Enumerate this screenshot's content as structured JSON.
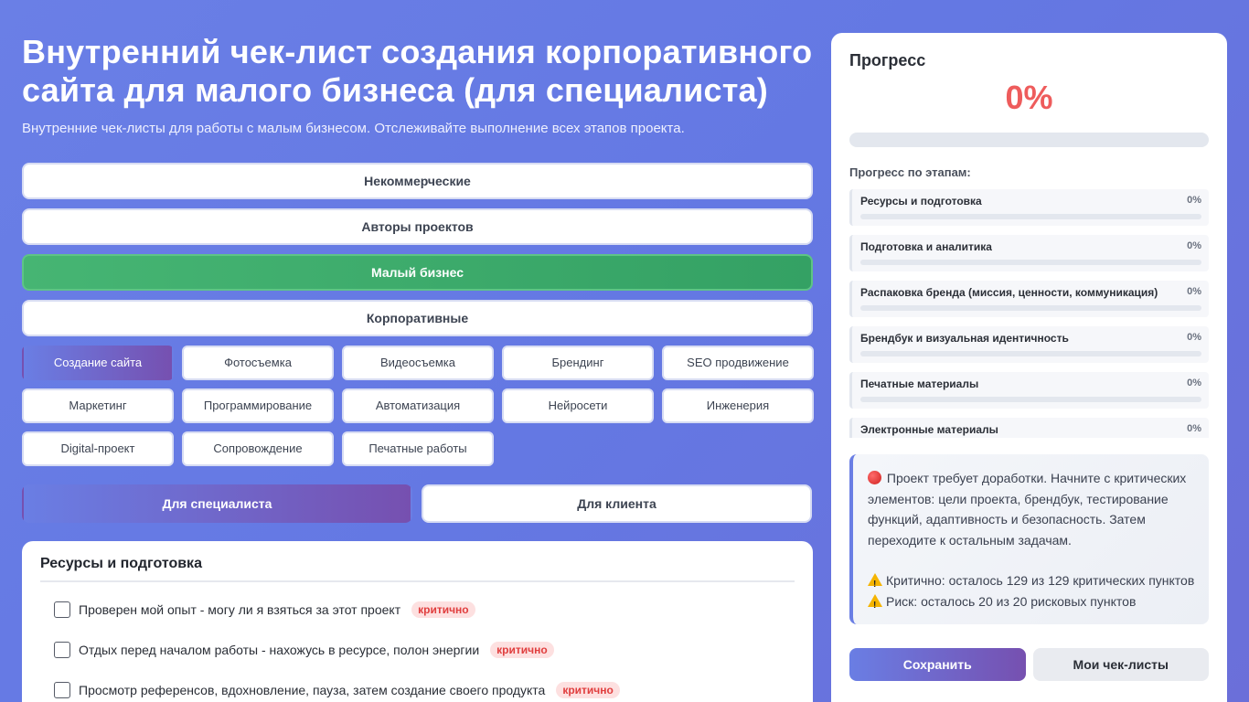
{
  "header": {
    "title": "Внутренний чек-лист создания корпоративного сайта для малого бизнеса (для специалиста)",
    "subtitle": "Внутренние чек-листы для работы с малым бизнесом. Отслеживайте выполнение всех этапов проекта."
  },
  "categories": [
    {
      "label": "Некоммерческие",
      "active": false
    },
    {
      "label": "Авторы проектов",
      "active": false
    },
    {
      "label": "Малый бизнес",
      "active": true
    },
    {
      "label": "Корпоративные",
      "active": false
    }
  ],
  "services": [
    {
      "label": "Создание сайта",
      "active": true
    },
    {
      "label": "Фотосъемка",
      "active": false
    },
    {
      "label": "Видеосъемка",
      "active": false
    },
    {
      "label": "Брендинг",
      "active": false
    },
    {
      "label": "SEO продвижение",
      "active": false
    },
    {
      "label": "Маркетинг",
      "active": false
    },
    {
      "label": "Программирование",
      "active": false
    },
    {
      "label": "Автоматизация",
      "active": false
    },
    {
      "label": "Нейросети",
      "active": false
    },
    {
      "label": "Инженерия",
      "active": false
    },
    {
      "label": "Digital-проект",
      "active": false
    },
    {
      "label": "Сопровождение",
      "active": false
    },
    {
      "label": "Печатные работы",
      "active": false
    }
  ],
  "modes": [
    {
      "label": "Для специалиста",
      "active": true
    },
    {
      "label": "Для клиента",
      "active": false
    }
  ],
  "section": {
    "title": "Ресурсы и подготовка",
    "tasks": [
      {
        "text": "Проверен мой опыт - могу ли я взяться за этот проект",
        "badge": "критично",
        "checked": false
      },
      {
        "text": "Отдых перед началом работы - нахожусь в ресурсе, полон энергии",
        "badge": "критично",
        "checked": false
      },
      {
        "text": "Просмотр референсов, вдохновление, пауза, затем создание своего продукта",
        "badge": "критично",
        "checked": false
      }
    ]
  },
  "progress": {
    "title": "Прогресс",
    "percent_label": "0%",
    "percent_value": 0,
    "stages_title": "Прогресс по этапам:",
    "stages": [
      {
        "name": "Ресурсы и подготовка",
        "pct_label": "0%",
        "value": 0
      },
      {
        "name": "Подготовка и аналитика",
        "pct_label": "0%",
        "value": 0
      },
      {
        "name": "Распаковка бренда (миссия, ценности, коммуникация)",
        "pct_label": "0%",
        "value": 0
      },
      {
        "name": "Брендбук и визуальная идентичность",
        "pct_label": "0%",
        "value": 0
      },
      {
        "name": "Печатные материалы",
        "pct_label": "0%",
        "value": 0
      },
      {
        "name": "Электронные материалы",
        "pct_label": "0%",
        "value": 0
      }
    ],
    "advice": {
      "main": "Проект требует доработки. Начните с критических элементов: цели проекта, брендбук, тестирование функций, адаптивность и безопасность. Затем переходите к остальным задачам.",
      "critical": "Критично: осталось 129 из 129 критических пунктов",
      "risk": "Риск: осталось 20 из 20 рисковых пунктов"
    },
    "accent_color": "#ee5c5c"
  },
  "actions": {
    "save_label": "Сохранить",
    "my_lists_label": "Мои чек-листы"
  }
}
